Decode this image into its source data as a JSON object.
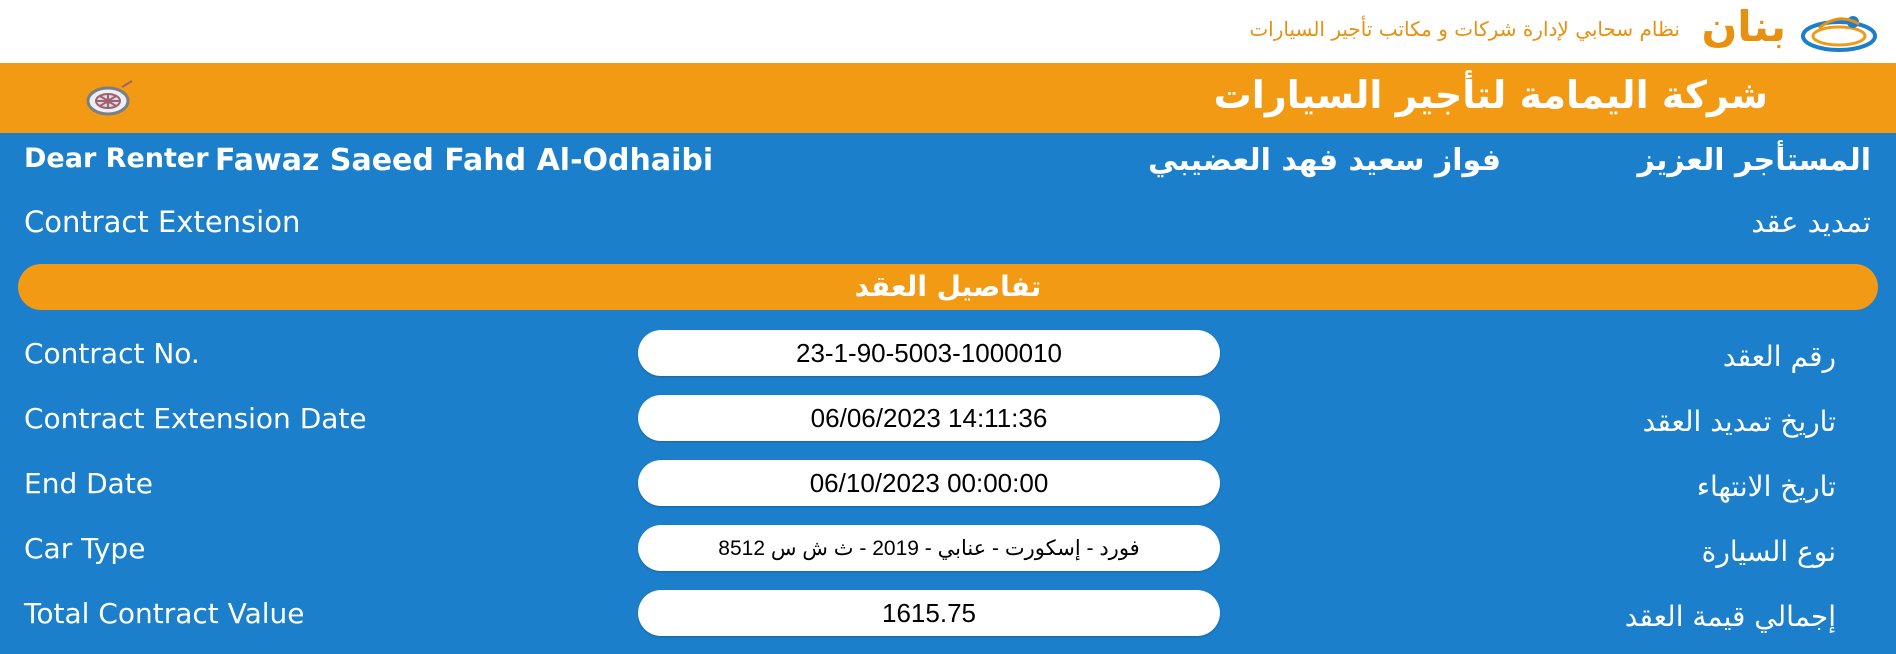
{
  "brand": {
    "name": "بنان",
    "tagline": "نظام سحابي لإدارة شركات و مكاتب تأجير السيارات",
    "color": "#e8900f"
  },
  "company": {
    "name": "شركة اليمامة لتأجير السيارات",
    "bar_color": "#f39a14"
  },
  "renter": {
    "label_en": "Dear Renter",
    "name_en": "Fawaz Saeed Fahd Al-Odhaibi",
    "name_ar": "فواز سعيد فهد العضيبي",
    "label_ar": "المستأجر العزيز"
  },
  "operation": {
    "title_en": "Contract Extension",
    "title_ar": "تمديد عقد"
  },
  "section": {
    "title": "تفاصيل العقد"
  },
  "details": [
    {
      "label_en": "Contract No.",
      "value": "23-1-90-5003-1000010",
      "label_ar": "رقم العقد"
    },
    {
      "label_en": "Contract Extension Date",
      "value": "06/06/2023 14:11:36",
      "label_ar": "تاريخ تمديد العقد"
    },
    {
      "label_en": "End Date",
      "value": "06/10/2023 00:00:00",
      "label_ar": "تاريخ الانتهاء"
    },
    {
      "label_en": "Car Type",
      "value": "فورد - إسكورت - عنابي - 2019 - ث ش س 8512",
      "label_ar": "نوع السيارة"
    },
    {
      "label_en": "Total Contract Value",
      "value": "1615.75",
      "label_ar": "إجمالي قيمة العقد"
    }
  ],
  "colors": {
    "background": "#1b7fcc",
    "accent": "#f39a14"
  }
}
